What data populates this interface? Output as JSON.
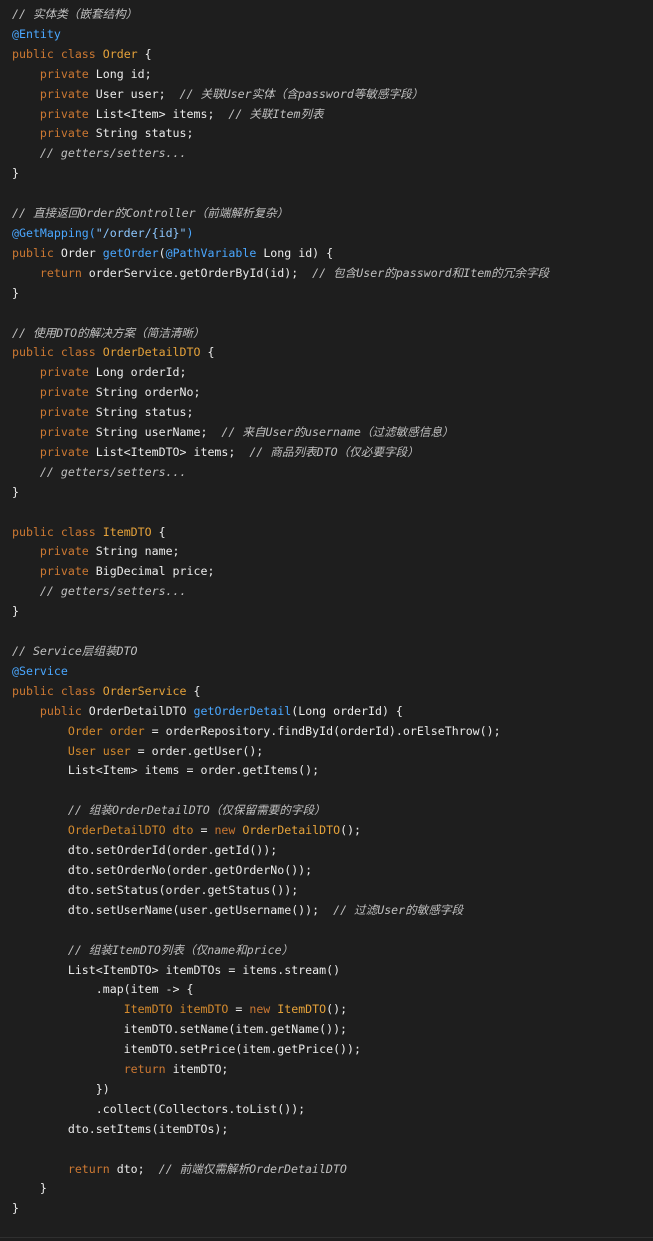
{
  "colors": {
    "background": "#1e1e1e",
    "keyword": "#cc7832",
    "annotation": "#4aa7ff",
    "class_name": "#e5a23a",
    "method_name": "#4aa7ff",
    "string": "#8ec8ff",
    "comment": "#c0c0c0",
    "plain": "#ececec",
    "local_var": "#d48a2e"
  },
  "code": {
    "lines": [
      [
        {
          "t": "cmt",
          "v": "// 实体类（嵌套结构）"
        }
      ],
      [
        {
          "t": "ann",
          "v": "@Entity"
        }
      ],
      [
        {
          "t": "kw",
          "v": "public class "
        },
        {
          "t": "cls",
          "v": "Order"
        },
        {
          "t": "plain",
          "v": " {"
        }
      ],
      [
        {
          "t": "plain",
          "v": "    "
        },
        {
          "t": "kw",
          "v": "private "
        },
        {
          "t": "plain",
          "v": "Long id;"
        }
      ],
      [
        {
          "t": "plain",
          "v": "    "
        },
        {
          "t": "kw",
          "v": "private "
        },
        {
          "t": "plain",
          "v": "User user;  "
        },
        {
          "t": "cmt",
          "v": "// 关联User实体（含password等敏感字段）"
        }
      ],
      [
        {
          "t": "plain",
          "v": "    "
        },
        {
          "t": "kw",
          "v": "private "
        },
        {
          "t": "plain",
          "v": "List<Item> items;  "
        },
        {
          "t": "cmt",
          "v": "// 关联Item列表"
        }
      ],
      [
        {
          "t": "plain",
          "v": "    "
        },
        {
          "t": "kw",
          "v": "private "
        },
        {
          "t": "plain",
          "v": "String status;"
        }
      ],
      [
        {
          "t": "plain",
          "v": "    "
        },
        {
          "t": "cmt",
          "v": "// getters/setters..."
        }
      ],
      [
        {
          "t": "plain",
          "v": "}"
        }
      ],
      [],
      [
        {
          "t": "cmt",
          "v": "// 直接返回Order的Controller（前端解析复杂）"
        }
      ],
      [
        {
          "t": "ann",
          "v": "@GetMapping("
        },
        {
          "t": "str",
          "v": "\"/order/{id}\""
        },
        {
          "t": "ann",
          "v": ")"
        }
      ],
      [
        {
          "t": "kw",
          "v": "public "
        },
        {
          "t": "plain",
          "v": "Order "
        },
        {
          "t": "method",
          "v": "getOrder"
        },
        {
          "t": "plain",
          "v": "("
        },
        {
          "t": "ann",
          "v": "@PathVariable"
        },
        {
          "t": "plain",
          "v": " Long id) {"
        }
      ],
      [
        {
          "t": "plain",
          "v": "    "
        },
        {
          "t": "kw",
          "v": "return "
        },
        {
          "t": "plain",
          "v": "orderService.getOrderById(id);  "
        },
        {
          "t": "cmt",
          "v": "// 包含User的password和Item的冗余字段"
        }
      ],
      [
        {
          "t": "plain",
          "v": "}"
        }
      ],
      [],
      [
        {
          "t": "cmt",
          "v": "// 使用DTO的解决方案（简洁清晰）"
        }
      ],
      [
        {
          "t": "kw",
          "v": "public class "
        },
        {
          "t": "cls",
          "v": "OrderDetailDTO"
        },
        {
          "t": "plain",
          "v": " {"
        }
      ],
      [
        {
          "t": "plain",
          "v": "    "
        },
        {
          "t": "kw",
          "v": "private "
        },
        {
          "t": "plain",
          "v": "Long orderId;"
        }
      ],
      [
        {
          "t": "plain",
          "v": "    "
        },
        {
          "t": "kw",
          "v": "private "
        },
        {
          "t": "plain",
          "v": "String orderNo;"
        }
      ],
      [
        {
          "t": "plain",
          "v": "    "
        },
        {
          "t": "kw",
          "v": "private "
        },
        {
          "t": "plain",
          "v": "String status;"
        }
      ],
      [
        {
          "t": "plain",
          "v": "    "
        },
        {
          "t": "kw",
          "v": "private "
        },
        {
          "t": "plain",
          "v": "String userName;  "
        },
        {
          "t": "cmt",
          "v": "// 来自User的username（过滤敏感信息）"
        }
      ],
      [
        {
          "t": "plain",
          "v": "    "
        },
        {
          "t": "kw",
          "v": "private "
        },
        {
          "t": "plain",
          "v": "List<ItemDTO> items;  "
        },
        {
          "t": "cmt",
          "v": "// 商品列表DTO（仅必要字段）"
        }
      ],
      [
        {
          "t": "plain",
          "v": "    "
        },
        {
          "t": "cmt",
          "v": "// getters/setters..."
        }
      ],
      [
        {
          "t": "plain",
          "v": "}"
        }
      ],
      [],
      [
        {
          "t": "kw",
          "v": "public class "
        },
        {
          "t": "cls",
          "v": "ItemDTO"
        },
        {
          "t": "plain",
          "v": " {"
        }
      ],
      [
        {
          "t": "plain",
          "v": "    "
        },
        {
          "t": "kw",
          "v": "private "
        },
        {
          "t": "plain",
          "v": "String name;"
        }
      ],
      [
        {
          "t": "plain",
          "v": "    "
        },
        {
          "t": "kw",
          "v": "private "
        },
        {
          "t": "plain",
          "v": "BigDecimal price;"
        }
      ],
      [
        {
          "t": "plain",
          "v": "    "
        },
        {
          "t": "cmt",
          "v": "// getters/setters..."
        }
      ],
      [
        {
          "t": "plain",
          "v": "}"
        }
      ],
      [],
      [
        {
          "t": "cmt",
          "v": "// Service层组装DTO"
        }
      ],
      [
        {
          "t": "ann",
          "v": "@Service"
        }
      ],
      [
        {
          "t": "kw",
          "v": "public class "
        },
        {
          "t": "cls",
          "v": "OrderService"
        },
        {
          "t": "plain",
          "v": " {"
        }
      ],
      [
        {
          "t": "plain",
          "v": "    "
        },
        {
          "t": "kw",
          "v": "public "
        },
        {
          "t": "plain",
          "v": "OrderDetailDTO "
        },
        {
          "t": "method",
          "v": "getOrderDetail"
        },
        {
          "t": "plain",
          "v": "(Long orderId) {"
        }
      ],
      [
        {
          "t": "plain",
          "v": "        "
        },
        {
          "t": "var",
          "v": "Order order"
        },
        {
          "t": "plain",
          "v": " = orderRepository.findById(orderId).orElseThrow();"
        }
      ],
      [
        {
          "t": "plain",
          "v": "        "
        },
        {
          "t": "var",
          "v": "User user"
        },
        {
          "t": "plain",
          "v": " = order.getUser();"
        }
      ],
      [
        {
          "t": "plain",
          "v": "        List<Item> items = order.getItems();"
        }
      ],
      [],
      [
        {
          "t": "plain",
          "v": "        "
        },
        {
          "t": "cmt",
          "v": "// 组装OrderDetailDTO（仅保留需要的字段）"
        }
      ],
      [
        {
          "t": "plain",
          "v": "        "
        },
        {
          "t": "var",
          "v": "OrderDetailDTO dto"
        },
        {
          "t": "plain",
          "v": " = "
        },
        {
          "t": "kw",
          "v": "new "
        },
        {
          "t": "cls",
          "v": "OrderDetailDTO"
        },
        {
          "t": "plain",
          "v": "();"
        }
      ],
      [
        {
          "t": "plain",
          "v": "        dto.setOrderId(order.getId());"
        }
      ],
      [
        {
          "t": "plain",
          "v": "        dto.setOrderNo(order.getOrderNo());"
        }
      ],
      [
        {
          "t": "plain",
          "v": "        dto.setStatus(order.getStatus());"
        }
      ],
      [
        {
          "t": "plain",
          "v": "        dto.setUserName(user.getUsername());  "
        },
        {
          "t": "cmt",
          "v": "// 过滤User的敏感字段"
        }
      ],
      [],
      [
        {
          "t": "plain",
          "v": "        "
        },
        {
          "t": "cmt",
          "v": "// 组装ItemDTO列表（仅name和price）"
        }
      ],
      [
        {
          "t": "plain",
          "v": "        List<ItemDTO> itemDTOs = items.stream()"
        }
      ],
      [
        {
          "t": "plain",
          "v": "            .map(item -> {"
        }
      ],
      [
        {
          "t": "plain",
          "v": "                "
        },
        {
          "t": "var",
          "v": "ItemDTO itemDTO"
        },
        {
          "t": "plain",
          "v": " = "
        },
        {
          "t": "kw",
          "v": "new "
        },
        {
          "t": "cls",
          "v": "ItemDTO"
        },
        {
          "t": "plain",
          "v": "();"
        }
      ],
      [
        {
          "t": "plain",
          "v": "                itemDTO.setName(item.getName());"
        }
      ],
      [
        {
          "t": "plain",
          "v": "                itemDTO.setPrice(item.getPrice());"
        }
      ],
      [
        {
          "t": "plain",
          "v": "                "
        },
        {
          "t": "kw",
          "v": "return "
        },
        {
          "t": "plain",
          "v": "itemDTO;"
        }
      ],
      [
        {
          "t": "plain",
          "v": "            })"
        }
      ],
      [
        {
          "t": "plain",
          "v": "            .collect(Collectors.toList());"
        }
      ],
      [
        {
          "t": "plain",
          "v": "        dto.setItems(itemDTOs);"
        }
      ],
      [],
      [
        {
          "t": "plain",
          "v": "        "
        },
        {
          "t": "kw",
          "v": "return "
        },
        {
          "t": "plain",
          "v": "dto;  "
        },
        {
          "t": "cmt",
          "v": "// 前端仅需解析OrderDetailDTO"
        }
      ],
      [
        {
          "t": "plain",
          "v": "    }"
        }
      ],
      [
        {
          "t": "plain",
          "v": "}"
        }
      ]
    ]
  }
}
